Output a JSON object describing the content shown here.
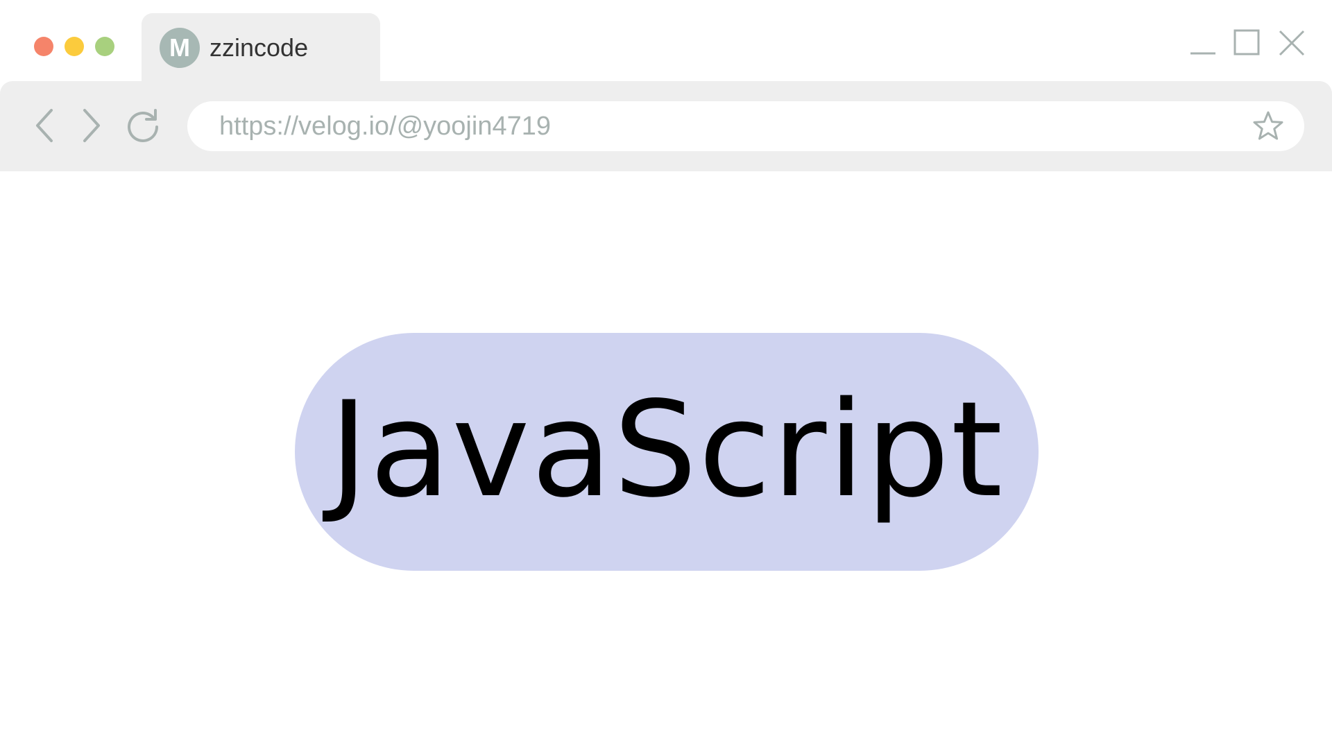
{
  "window": {
    "controls": {
      "close_color": "#f5846a",
      "minimize_color": "#fbcb3d",
      "zoom_color": "#a8d07e"
    }
  },
  "tab": {
    "favicon_letter": "M",
    "favicon_color": "#a7b8b4",
    "title": "zzincode"
  },
  "toolbar": {
    "icons": {
      "back": "chevron-left-icon",
      "forward": "chevron-right-icon",
      "reload": "reload-icon",
      "bookmark": "star-icon"
    },
    "icon_color": "#a8b2b0",
    "address": {
      "url": "https://velog.io/@yoojin4719"
    }
  },
  "main": {
    "badge": {
      "label": "JavaScript",
      "background": "#cfd3f0"
    }
  }
}
